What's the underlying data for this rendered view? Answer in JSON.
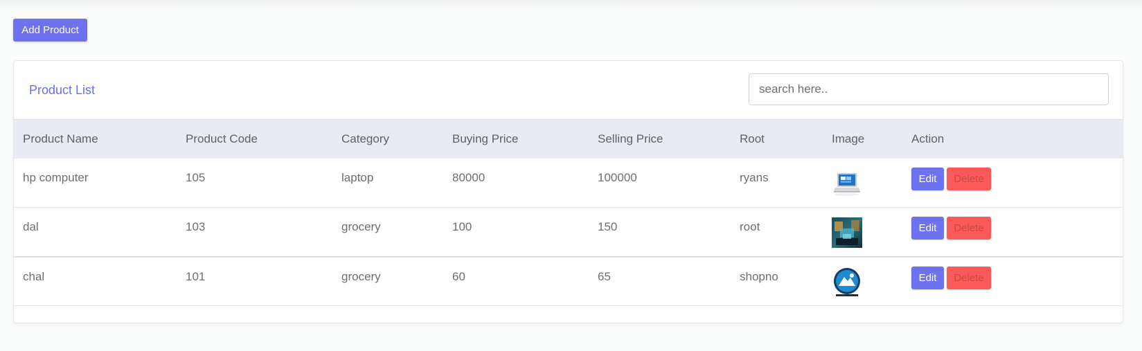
{
  "toolbar": {
    "add_product_label": "Add Product"
  },
  "card": {
    "title": "Product List",
    "search_placeholder": "search here.."
  },
  "table": {
    "columns": [
      "Product Name",
      "Product Code",
      "Category",
      "Buying Price",
      "Selling Price",
      "Root",
      "Image",
      "Action"
    ],
    "rows": [
      {
        "name": "hp computer",
        "code": "105",
        "category": "laptop",
        "buying_price": "80000",
        "selling_price": "100000",
        "root": "ryans",
        "image_icon": "laptop-thumbnail",
        "edit_label": "Edit",
        "delete_label": "Delete"
      },
      {
        "name": "dal",
        "code": "103",
        "category": "grocery",
        "buying_price": "100",
        "selling_price": "150",
        "root": "root",
        "image_icon": "scene-thumbnail",
        "edit_label": "Edit",
        "delete_label": "Delete"
      },
      {
        "name": "chal",
        "code": "101",
        "category": "grocery",
        "buying_price": "60",
        "selling_price": "65",
        "root": "shopno",
        "image_icon": "logo-thumbnail",
        "edit_label": "Edit",
        "delete_label": "Delete"
      }
    ]
  },
  "colors": {
    "accent": "#6f72ee",
    "danger": "#fb5a58",
    "header_bg": "#e8ebf2"
  }
}
